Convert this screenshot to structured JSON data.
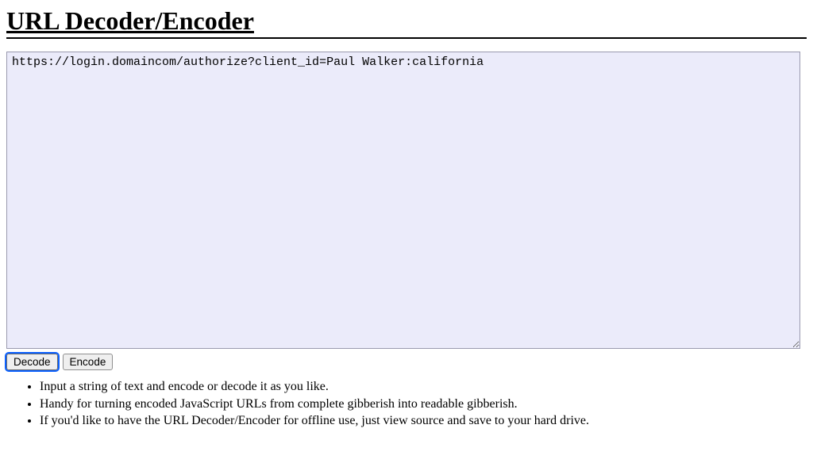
{
  "header": {
    "title": "URL Decoder/Encoder"
  },
  "textarea": {
    "value": "https://login.domaincom/authorize?client_id=Paul Walker:california"
  },
  "buttons": {
    "decode_label": "Decode",
    "encode_label": "Encode"
  },
  "instructions": {
    "items": [
      "Input a string of text and encode or decode it as you like.",
      "Handy for turning encoded JavaScript URLs from complete gibberish into readable gibberish.",
      "If you'd like to have the URL Decoder/Encoder for offline use, just view source and save to your hard drive."
    ]
  }
}
